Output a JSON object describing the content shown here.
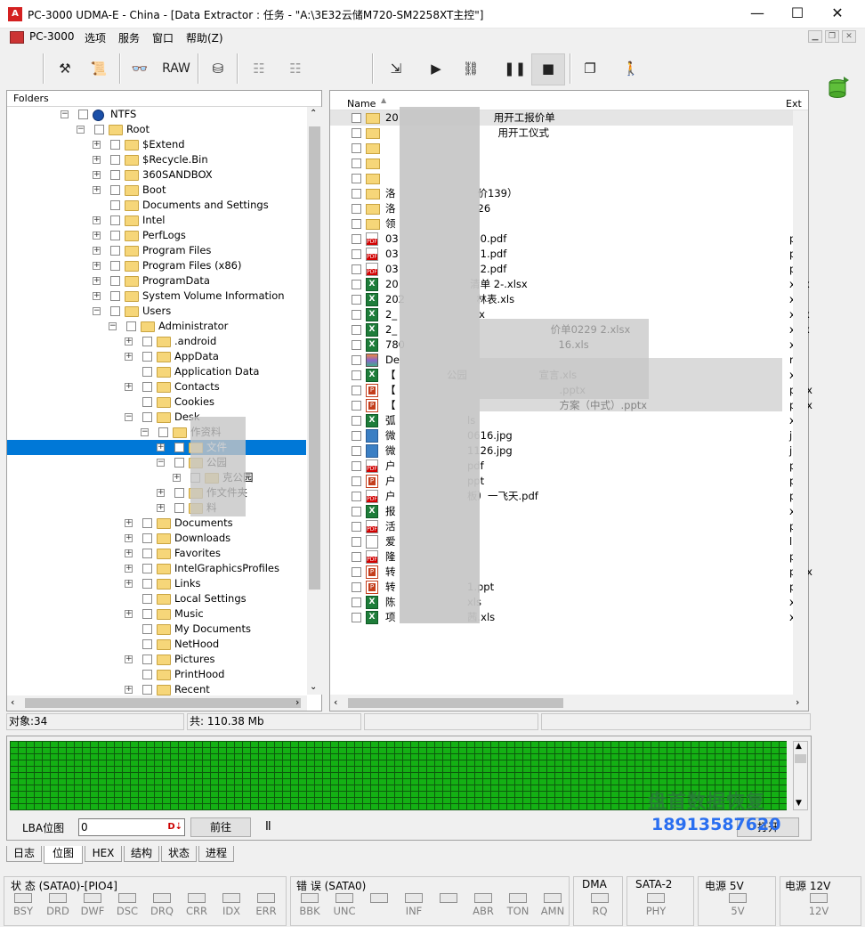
{
  "window": {
    "title": "PC-3000 UDMA-E - China - [Data Extractor : 任务 - \"A:\\3E32云储M720-SM2258XT主控\"]",
    "minimize": "—",
    "maximize": "☐",
    "close": "✕"
  },
  "menu": [
    "PC-3000",
    "选项",
    "服务",
    "窗口",
    "帮助(Z)"
  ],
  "toolbar": {
    "raw_label": "RAW"
  },
  "tree": {
    "header": "Folders",
    "nodes": [
      {
        "label": "NTFS",
        "exp": "−"
      },
      {
        "label": "Root",
        "exp": "−"
      },
      {
        "label": "$Extend",
        "exp": "+"
      },
      {
        "label": "$Recycle.Bin",
        "exp": "+"
      },
      {
        "label": "360SANDBOX",
        "exp": "+"
      },
      {
        "label": "Boot",
        "exp": "+"
      },
      {
        "label": "Documents and Settings",
        "exp": ""
      },
      {
        "label": "Intel",
        "exp": "+"
      },
      {
        "label": "PerfLogs",
        "exp": "+"
      },
      {
        "label": "Program Files",
        "exp": "+"
      },
      {
        "label": "Program Files (x86)",
        "exp": "+"
      },
      {
        "label": "ProgramData",
        "exp": "+"
      },
      {
        "label": "System Volume Information",
        "exp": "+"
      },
      {
        "label": "Users",
        "exp": "−"
      },
      {
        "label": "Administrator",
        "exp": "−"
      },
      {
        "label": ".android",
        "exp": "+"
      },
      {
        "label": "AppData",
        "exp": "+"
      },
      {
        "label": "Application Data",
        "exp": ""
      },
      {
        "label": "Contacts",
        "exp": "+"
      },
      {
        "label": "Cookies",
        "exp": ""
      },
      {
        "label": "Desk",
        "exp": "−"
      },
      {
        "label": "作资料",
        "exp": "−"
      },
      {
        "label": "文件",
        "exp": "+"
      },
      {
        "label": "公园",
        "exp": "−"
      },
      {
        "label": "克公园",
        "exp": "+"
      },
      {
        "label": "作文件夹",
        "exp": "+"
      },
      {
        "label": "料",
        "exp": "+"
      },
      {
        "label": "Documents",
        "exp": "+"
      },
      {
        "label": "Downloads",
        "exp": "+"
      },
      {
        "label": "Favorites",
        "exp": "+"
      },
      {
        "label": "IntelGraphicsProfiles",
        "exp": "+"
      },
      {
        "label": "Links",
        "exp": "+"
      },
      {
        "label": "Local Settings",
        "exp": ""
      },
      {
        "label": "Music",
        "exp": "+"
      },
      {
        "label": "My Documents",
        "exp": ""
      },
      {
        "label": "NetHood",
        "exp": ""
      },
      {
        "label": "Pictures",
        "exp": "+"
      },
      {
        "label": "PrintHood",
        "exp": ""
      },
      {
        "label": "Recent",
        "exp": "+"
      }
    ]
  },
  "list": {
    "col_name": "Name",
    "col_ext": "Ext",
    "rows": [
      {
        "icon": "folder",
        "name": "20 　　　　　　　　　用开工报价单",
        "ext": ""
      },
      {
        "icon": "folder",
        "name": "　　　　　　　　　　　用开工仪式",
        "ext": ""
      },
      {
        "icon": "folder",
        "name": "",
        "ext": ""
      },
      {
        "icon": "folder",
        "name": "",
        "ext": ""
      },
      {
        "icon": "folder",
        "name": "",
        "ext": ""
      },
      {
        "icon": "folder",
        "name": "洛　　　　　　　　价139）",
        "ext": ""
      },
      {
        "icon": "folder",
        "name": "洛　　　　　　　　26",
        "ext": ""
      },
      {
        "icon": "folder",
        "name": "领",
        "ext": ""
      },
      {
        "icon": "pdf",
        "name": "03　　　　　　　　0.pdf",
        "ext": "pdf"
      },
      {
        "icon": "pdf",
        "name": "03　　　　　　　　1.pdf",
        "ext": "pdf"
      },
      {
        "icon": "pdf",
        "name": "03　　　　　　　　2.pdf",
        "ext": "pdf"
      },
      {
        "icon": "xls",
        "name": "20　　　　　　　清单 2-.xlsx",
        "ext": "xlsx"
      },
      {
        "icon": "xls",
        "name": "202　　　　　　　林表.xls",
        "ext": "xls"
      },
      {
        "icon": "xls",
        "name": "2_　　　　　　　　x",
        "ext": "xlsx"
      },
      {
        "icon": "xls",
        "name": "2_　　　　　　　　　　　　　　　价单0229 2.xlsx",
        "ext": "xlsx"
      },
      {
        "icon": "xls",
        "name": "780　　　　　　　　　　　　　　　16.xls",
        "ext": "xls"
      },
      {
        "icon": "rar",
        "name": "De",
        "ext": "rar"
      },
      {
        "icon": "xls",
        "name": "【　　　　　公园　　　　　　　宣言.xls",
        "ext": "xls"
      },
      {
        "icon": "ppt",
        "name": "【　　　　　　　　　　　　　　　　.pptx",
        "ext": "pptx"
      },
      {
        "icon": "ppt",
        "name": "【　　　　　　　　　　　　　　　　方案（中式）.pptx",
        "ext": "pptx"
      },
      {
        "icon": "xls",
        "name": "弧　　　　　　　ls",
        "ext": "xls"
      },
      {
        "icon": "img",
        "name": "微　　　　　　　0616.jpg",
        "ext": "jpg"
      },
      {
        "icon": "img",
        "name": "微　　　　　　　1126.jpg",
        "ext": "jpg"
      },
      {
        "icon": "pdf",
        "name": "户　　　　　　　pdf",
        "ext": "pdf"
      },
      {
        "icon": "ppt",
        "name": "户　　　　　　　ppt",
        "ext": "ppt"
      },
      {
        "icon": "pdf",
        "name": "户　　　　　　　板）一飞天.pdf",
        "ext": "pdf"
      },
      {
        "icon": "xls",
        "name": "报",
        "ext": "xls"
      },
      {
        "icon": "pdf",
        "name": "活",
        "ext": "pdf"
      },
      {
        "icon": "lnk",
        "name": "爱",
        "ext": "lnk"
      },
      {
        "icon": "pdf",
        "name": "隆",
        "ext": "pdf"
      },
      {
        "icon": "ppt",
        "name": "转",
        "ext": "pptx"
      },
      {
        "icon": "ppt",
        "name": "转　　　　　　　1.ppt",
        "ext": "ppt"
      },
      {
        "icon": "xls",
        "name": "陈　　　　　　　xls",
        "ext": "xls"
      },
      {
        "icon": "xls",
        "name": "项　　　　　　　茜.xls",
        "ext": "xls"
      }
    ]
  },
  "status": {
    "objects": "对象:34",
    "total": "共:  110.38 Mb"
  },
  "lba": {
    "label": "LBA位图",
    "value": "0",
    "goto": "前往",
    "pause": "II",
    "open": "打开"
  },
  "watermark": {
    "line1": "盘首数据恢复",
    "line2": "18913587620"
  },
  "tabs": [
    "日志",
    "位图",
    "HEX",
    "结构",
    "状态",
    "进程"
  ],
  "active_tab": "位图",
  "leds": {
    "status_title": "状 态 (SATA0)-[PIO4]",
    "status_leds": [
      "BSY",
      "DRD",
      "DWF",
      "DSC",
      "DRQ",
      "CRR",
      "IDX",
      "ERR"
    ],
    "error_title": "错 误 (SATA0)",
    "error_leds": [
      "BBK",
      "UNC",
      "",
      "INF",
      "",
      "ABR",
      "TON",
      "AMN"
    ],
    "dma_title": "DMA",
    "dma_leds": [
      "RQ"
    ],
    "sata_title": "SATA-2",
    "sata_leds": [
      "PHY"
    ],
    "p5_title": "电源 5V",
    "p5_leds": [
      "5V"
    ],
    "p12_title": "电源 12V",
    "p12_leds": [
      "12V"
    ]
  }
}
